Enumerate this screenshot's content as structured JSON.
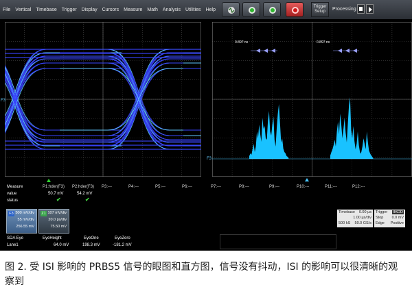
{
  "menu": [
    "File",
    "Vertical",
    "Timebase",
    "Trigger",
    "Display",
    "Cursors",
    "Measure",
    "Math",
    "Analysis",
    "Utilities",
    "Help"
  ],
  "toolbar": {
    "trigger_setup_line1": "Trigger",
    "trigger_setup_line2": "Setup",
    "processing": "Processing"
  },
  "histogram": {
    "marker_left": "0.897 ns",
    "marker_right": "0.897 ns"
  },
  "measure": {
    "row_labels": [
      "Measure",
      "value",
      "status"
    ],
    "headers": [
      "P1:hder(F3)",
      "P2:hder(F3)",
      "P3:---",
      "P4:---",
      "P5:---",
      "P6:---",
      "P7:---",
      "P8:---",
      "P9:---",
      "P10:---",
      "P11:---",
      "P12:---"
    ],
    "values": [
      "50.7 mV",
      "54.2 mV"
    ]
  },
  "f3": {
    "tag": "F3",
    "line1": "500 mV/div",
    "line2": "55 mV/div",
    "line3": "256.55 mV"
  },
  "z1": {
    "tag": "Z1",
    "line1": "107 mV/div",
    "line2": "20.0 ps/div",
    "line3": "75.50 mV"
  },
  "timebase": {
    "label": "Timebase",
    "value": "0.00 µs",
    "line2": "1.00 µs/div",
    "line3a": "500 kS",
    "line3b": "50.0 GS/s"
  },
  "trigger": {
    "label": "Trigger",
    "badge": "IIKDD",
    "r1a": "Stop",
    "r1b": "0.0 mV",
    "r2a": "Edge",
    "r2b": "Positive"
  },
  "eye": {
    "row1": [
      "SDA Eye",
      "EyeHeight",
      "EyeOne",
      "EyeZero"
    ],
    "row2": [
      "Lane1",
      "64.0 mV",
      "198.3 mV",
      "-181.2 mV"
    ]
  },
  "caption": "图 2. 受 ISI 影响的 PRBS5 信号的眼图和直方图，信号没有抖动，ISI 的影响可以很清晰的观察到",
  "colors": {
    "eye": "#3a44ff",
    "eye_highlight": "#66e0ff",
    "histogram": "#19c2ff",
    "grid": "#6a6a6a"
  }
}
